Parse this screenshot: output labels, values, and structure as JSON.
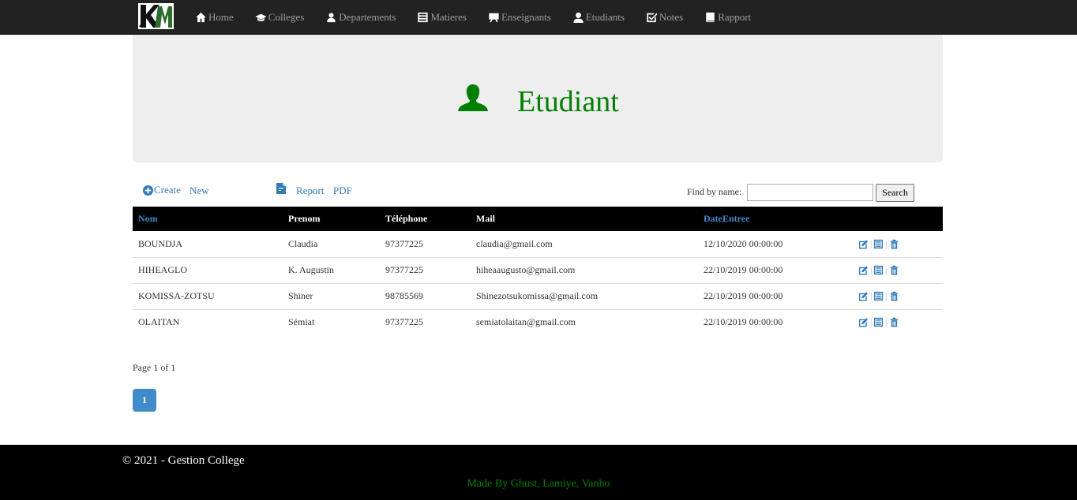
{
  "navbar": {
    "brand_logo_text": "KM",
    "items": [
      {
        "label": "Home",
        "icon": "home-icon"
      },
      {
        "label": "Colleges",
        "icon": "graduation-cap-icon"
      },
      {
        "label": "Departements",
        "icon": "user-tie-icon"
      },
      {
        "label": "Matieres",
        "icon": "list-alt-icon"
      },
      {
        "label": "Enseignants",
        "icon": "blackboard-icon"
      },
      {
        "label": "Etudiants",
        "icon": "user-icon"
      },
      {
        "label": "Notes",
        "icon": "check-icon"
      },
      {
        "label": "Rapport",
        "icon": "book-icon"
      }
    ]
  },
  "header": {
    "title": "Etudiant",
    "icon": "user-icon",
    "color": "#008000"
  },
  "toolbar": {
    "create_label": "Create",
    "new_label": "New",
    "report_label": "Report",
    "pdf_label": "PDF",
    "find_label": "Find by name:",
    "search_value": "",
    "search_button": "Search"
  },
  "table": {
    "columns": [
      "Nom",
      "Prenom",
      "Téléphone",
      "Mail",
      "DateEntree",
      ""
    ],
    "rows": [
      {
        "nom": "BOUNDJA",
        "prenom": "Claudia",
        "telephone": "97377225",
        "mail": "claudia@gmail.com",
        "date": "12/10/2020 00:00:00"
      },
      {
        "nom": "HIHEAGLO",
        "prenom": "K. Augustin",
        "telephone": "97377225",
        "mail": "hiheaaugusto@gmail.com",
        "date": "22/10/2019 00:00:00"
      },
      {
        "nom": "KOMISSA-ZOTSU",
        "prenom": "Shiner",
        "telephone": "98785569",
        "mail": "Shinezotsukomissa@gmail.com",
        "date": "22/10/2019 00:00:00"
      },
      {
        "nom": "OLAITAN",
        "prenom": "Sémiat",
        "telephone": "97377225",
        "mail": "semiatolaitan@gmail.com",
        "date": "22/10/2019 00:00:00"
      }
    ],
    "action_icons": [
      "edit-icon",
      "details-icon",
      "trash-icon"
    ],
    "action_separator": "|",
    "link_color": "#337ab7"
  },
  "pagination": {
    "info": "Page 1 of 1",
    "current": "1"
  },
  "footer": {
    "copyright": "© 2021 - Gestion College",
    "credits": "Made By Ghust, Lamiye, Vanho"
  }
}
